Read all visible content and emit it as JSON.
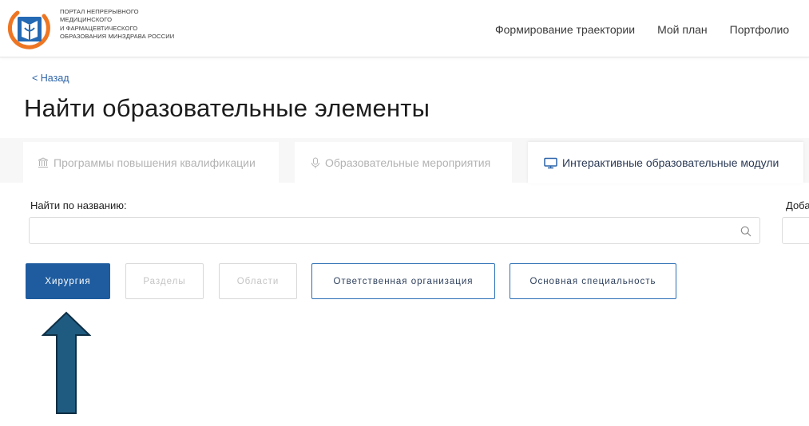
{
  "header": {
    "logo_lines": [
      "ПОРТАЛ НЕПРЕРЫВНОГО",
      "МЕДИЦИНСКОГО",
      "И ФАРМАЦЕВТИЧЕСКОГО",
      "ОБРАЗОВАНИЯ МИНЗДРАВА РОССИИ"
    ],
    "nav": [
      "Формирование траектории",
      "Мой план",
      "Портфолио"
    ]
  },
  "page": {
    "back_label": "< Назад",
    "title": "Найти образовательные элементы"
  },
  "tabs": [
    {
      "label": "Программы повышения квалификации",
      "icon": "bank-icon",
      "active": false
    },
    {
      "label": "Образовательные мероприятия",
      "icon": "microphone-icon",
      "active": false
    },
    {
      "label": "Интерактивные образовательные модули",
      "icon": "monitor-icon",
      "active": true
    }
  ],
  "search": {
    "label": "Найти по названию:",
    "value": "",
    "second_label": "Доба"
  },
  "filters": [
    {
      "label": "Хирургия",
      "state": "selected"
    },
    {
      "label": "Разделы",
      "state": "disabled"
    },
    {
      "label": "Области",
      "state": "disabled"
    },
    {
      "label": "Ответственная организация",
      "state": "enabled"
    },
    {
      "label": "Основная специальность",
      "state": "enabled"
    }
  ],
  "colors": {
    "primary": "#1f5c9f",
    "link": "#2b63a8",
    "arrow": "#1f5b80",
    "logo_orange": "#ee7623",
    "logo_blue": "#2469b3"
  }
}
